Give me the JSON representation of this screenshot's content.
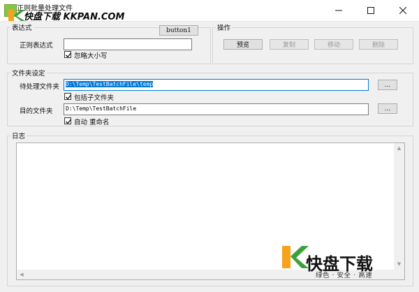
{
  "window": {
    "title": "正则批量处理文件",
    "controls": {
      "minimize": "minimize",
      "maximize": "maximize",
      "close": "close"
    }
  },
  "watermark": {
    "top_text": "快盘下载 KKPAN.COM",
    "bottom_title": "快盘下载",
    "bottom_subtitle": "绿色 · 安全 · 高速"
  },
  "expression_group": {
    "legend": "表达式",
    "button1_label": "button1",
    "regex_label": "正则表达式",
    "regex_value": "",
    "ignore_case_label": "忽略大小写",
    "ignore_case_checked": true
  },
  "operations_group": {
    "legend": "操作",
    "buttons": [
      {
        "label": "预览",
        "enabled": true
      },
      {
        "label": "复制",
        "enabled": false
      },
      {
        "label": "移动",
        "enabled": false
      },
      {
        "label": "删除",
        "enabled": false
      }
    ]
  },
  "folder_group": {
    "legend": "文件夹设定",
    "source_label": "待处理文件夹",
    "source_value": "D:\\Temp\\TestBatchFile\\temp",
    "source_browse": "...",
    "include_subfolders_label": "包括子文件夹",
    "include_subfolders_checked": true,
    "target_label": "目的文件夹",
    "target_value": "D:\\Temp\\TestBatchFile",
    "target_browse": "...",
    "auto_rename_label": "自动 重命名",
    "auto_rename_checked": true
  },
  "log_group": {
    "legend": "日志",
    "content": ""
  },
  "colors": {
    "accent": "#0078d7",
    "window_bg": "#f0f0f0",
    "disabled_text": "#9b9b9b"
  }
}
